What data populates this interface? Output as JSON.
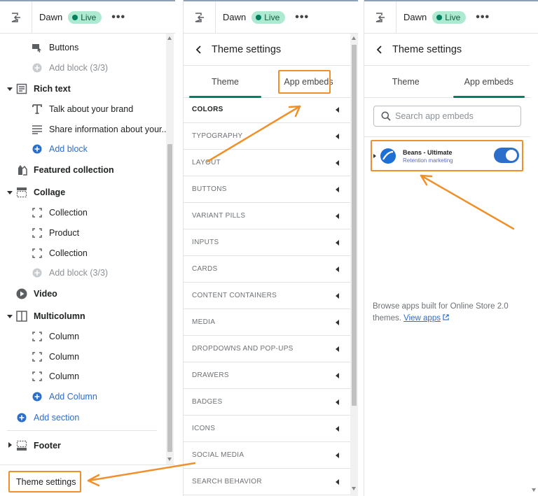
{
  "store_name": "Dawn",
  "live_label": "Live",
  "more_label": "•••",
  "left_panel": {
    "items": [
      {
        "label": "Buttons",
        "type": "block"
      },
      {
        "label": "Add block (3/3)",
        "type": "add-disabled"
      },
      {
        "label": "Rich text",
        "type": "section"
      },
      {
        "label": "Talk about your brand",
        "type": "block"
      },
      {
        "label": "Share information about your...",
        "type": "block"
      },
      {
        "label": "Add block",
        "type": "add"
      },
      {
        "label": "Featured collection",
        "type": "section"
      },
      {
        "label": "Collage",
        "type": "section"
      },
      {
        "label": "Collection",
        "type": "block"
      },
      {
        "label": "Product",
        "type": "block"
      },
      {
        "label": "Collection",
        "type": "block"
      },
      {
        "label": "Add block (3/3)",
        "type": "add-disabled"
      },
      {
        "label": "Video",
        "type": "section"
      },
      {
        "label": "Multicolumn",
        "type": "section"
      },
      {
        "label": "Column",
        "type": "block"
      },
      {
        "label": "Column",
        "type": "block"
      },
      {
        "label": "Column",
        "type": "block"
      },
      {
        "label": "Add Column",
        "type": "add"
      },
      {
        "label": "Add section",
        "type": "add-section"
      },
      {
        "label": "Footer",
        "type": "section"
      }
    ],
    "theme_settings_label": "Theme settings"
  },
  "theme_panel": {
    "title": "Theme settings",
    "tab_theme": "Theme",
    "tab_app_embeds": "App embeds",
    "settings": [
      "COLORS",
      "TYPOGRAPHY",
      "LAYOUT",
      "BUTTONS",
      "VARIANT PILLS",
      "INPUTS",
      "CARDS",
      "CONTENT CONTAINERS",
      "MEDIA",
      "DROPDOWNS AND POP-UPS",
      "DRAWERS",
      "BADGES",
      "ICONS",
      "SOCIAL MEDIA",
      "SEARCH BEHAVIOR"
    ]
  },
  "embeds_panel": {
    "title": "Theme settings",
    "tab_theme": "Theme",
    "tab_app_embeds": "App embeds",
    "search_placeholder": "Search app embeds",
    "embed_name": "Beans - Ultimate",
    "embed_subtitle": "Retention marketing",
    "embed_enabled": true,
    "browse_text": "Browse apps built for Online Store 2.0 themes.",
    "view_apps_label": "View apps"
  },
  "colors": {
    "highlight": "#f0902a",
    "accent_green": "#008060",
    "link_blue": "#2c6ecb",
    "live_badge": "#aee9d1"
  }
}
